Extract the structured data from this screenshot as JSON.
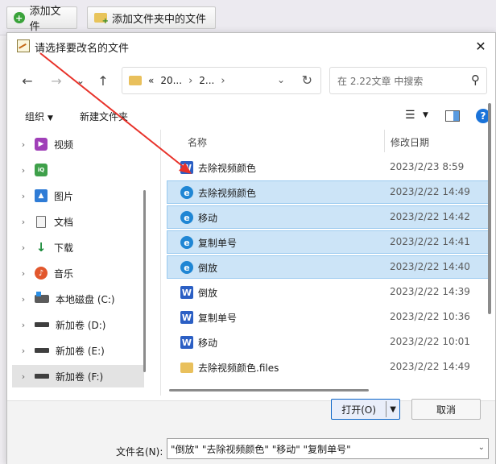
{
  "background_toolbar": {
    "add_file": "添加文件",
    "add_folder_files": "添加文件夹中的文件"
  },
  "dialog": {
    "title": "请选择要改名的文件",
    "close": "✕"
  },
  "navbar": {
    "back": "←",
    "forward": "→",
    "dropdown": "⌄",
    "up": "↑",
    "address": {
      "prefix": "«",
      "segment1": "20...",
      "segment2": "2...",
      "sep": "›"
    },
    "search_placeholder": "在 2.22文章 中搜索"
  },
  "cmdbar": {
    "organize": "组织",
    "new_folder": "新建文件夹"
  },
  "navpane": {
    "items": [
      {
        "label": "视频",
        "icon": "video-icon"
      },
      {
        "label": "",
        "icon": "iqiyi-icon"
      },
      {
        "label": "图片",
        "icon": "pictures-icon"
      },
      {
        "label": "文档",
        "icon": "documents-icon"
      },
      {
        "label": "下载",
        "icon": "downloads-icon"
      },
      {
        "label": "音乐",
        "icon": "music-icon"
      },
      {
        "label": "本地磁盘 (C:)",
        "icon": "disk-c-icon"
      },
      {
        "label": "新加卷 (D:)",
        "icon": "drive-icon"
      },
      {
        "label": "新加卷 (E:)",
        "icon": "drive-icon"
      },
      {
        "label": "新加卷 (F:)",
        "icon": "drive-icon",
        "selected": true
      }
    ]
  },
  "filelist": {
    "columns": {
      "name": "名称",
      "date": "修改日期"
    },
    "rows": [
      {
        "name": "去除视频颜色",
        "date": "2023/2/23 8:59",
        "type": "word",
        "selected": false
      },
      {
        "name": "去除视频颜色",
        "date": "2023/2/22 14:49",
        "type": "edge",
        "selected": true
      },
      {
        "name": "移动",
        "date": "2023/2/22 14:42",
        "type": "edge",
        "selected": true
      },
      {
        "name": "复制单号",
        "date": "2023/2/22 14:41",
        "type": "edge",
        "selected": true
      },
      {
        "name": "倒放",
        "date": "2023/2/22 14:40",
        "type": "edge",
        "selected": true
      },
      {
        "name": "倒放",
        "date": "2023/2/22 14:39",
        "type": "word",
        "selected": false
      },
      {
        "name": "复制单号",
        "date": "2023/2/22 10:36",
        "type": "word",
        "selected": false
      },
      {
        "name": "移动",
        "date": "2023/2/22 10:01",
        "type": "word",
        "selected": false
      },
      {
        "name": "去除视频颜色.files",
        "date": "2023/2/22 14:49",
        "type": "folder",
        "selected": false
      }
    ]
  },
  "footer": {
    "filename_label": "文件名(N):",
    "filename_value": "\"倒放\" \"去除视频颜色\" \"移动\" \"复制单号\"",
    "open_label": "打开(O)",
    "cancel_label": "取消"
  },
  "colors": {
    "selection": "#cce4f7",
    "accent": "#0a64c8",
    "annotation_arrow": "#e8322a"
  }
}
